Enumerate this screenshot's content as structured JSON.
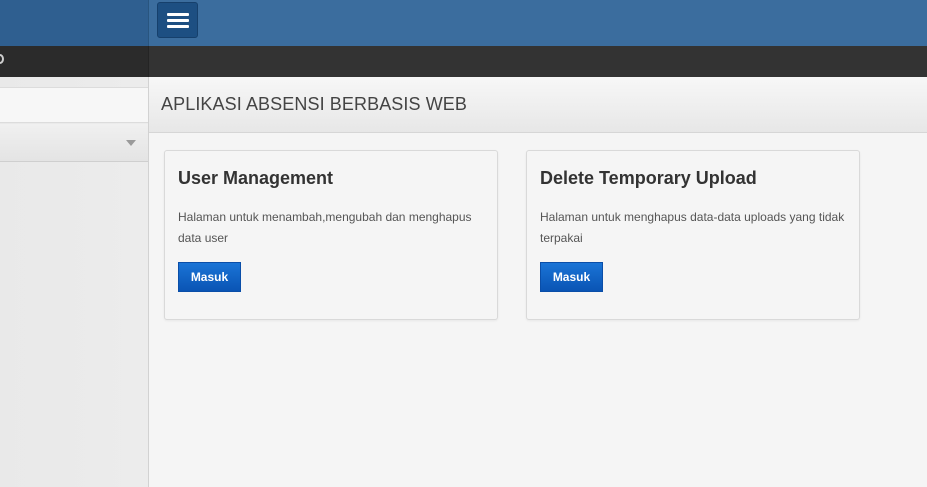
{
  "header": {
    "menu_toggle_icon": "hamburger-icon"
  },
  "sidebar": {
    "search_value": "",
    "select_value": ""
  },
  "page": {
    "title": "APLIKASI ABSENSI BERBASIS WEB"
  },
  "cards": [
    {
      "title": "User Management",
      "description": "Halaman untuk menambah,mengubah dan menghapus data user",
      "button_label": "Masuk"
    },
    {
      "title": "Delete Temporary Upload",
      "description": "Halaman untuk menghapus data-data uploads yang tidak terpakai",
      "button_label": "Masuk"
    }
  ],
  "colors": {
    "topbar": "#3b6d9e",
    "darkbar": "#333333",
    "button": "#0a54b4"
  }
}
